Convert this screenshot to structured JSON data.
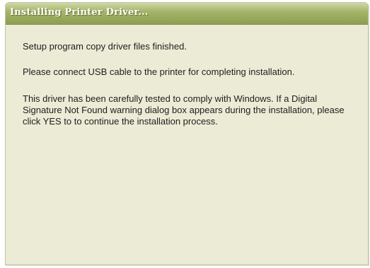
{
  "window": {
    "title": "Installing Printer Driver..."
  },
  "messages": {
    "line1": "Setup program copy driver files finished.",
    "line2": "Please connect USB cable to the printer for completing installation.",
    "line3": "This driver has been carefully tested to comply with Windows. If a Digital Signature Not Found warning dialog box appears during the installation, please click YES to to continue the installation process."
  },
  "colors": {
    "title_bar": "#97a85a",
    "dialog_background": "#ecebd6",
    "title_text": "#ffffff",
    "body_text": "#1e1e1e"
  }
}
